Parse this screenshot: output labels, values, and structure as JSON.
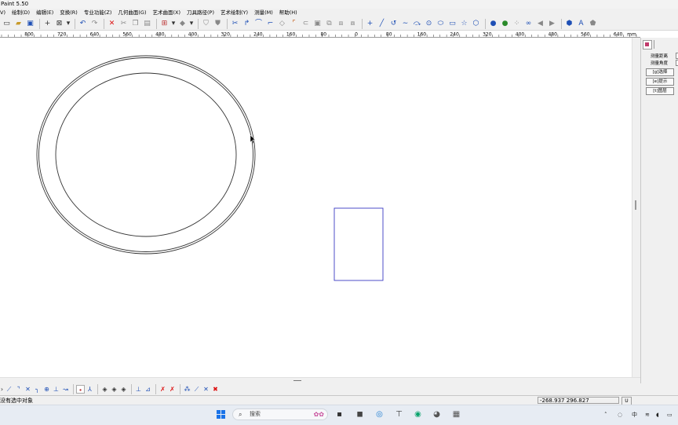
{
  "app": {
    "title": "Paint 5.50"
  },
  "menu": [
    "V)",
    "绘制(D)",
    "编辑(E)",
    "变换(R)",
    "专业功能(Z)",
    "几何曲面(G)",
    "艺术曲面(X)",
    "刀具路径(P)",
    "艺术绘制(Y)",
    "测量(M)",
    "帮助(H)"
  ],
  "ruler": {
    "unit": "mm",
    "labels": [
      "800",
      "720",
      "640",
      "560",
      "480",
      "400",
      "320",
      "240",
      "160",
      "80",
      "0",
      "80",
      "160",
      "240",
      "320",
      "400",
      "480",
      "560",
      "640"
    ]
  },
  "right_panel": {
    "distance_label": "测量距离",
    "angle_label": "测量角度",
    "select_button": "[g]选择",
    "hint_button": "[e]提示",
    "layer_button": "[t]图层"
  },
  "status": {
    "message": "没有选中对象",
    "coordinates": "-268.937 296.827",
    "indicator": "U"
  },
  "taskbar": {
    "search_placeholder": "搜索",
    "tray_input_method": "中"
  },
  "colors": {
    "rectangle_stroke": "#3b3bc4",
    "circle_stroke": "#333333",
    "start_icon": "#1a73e8"
  }
}
